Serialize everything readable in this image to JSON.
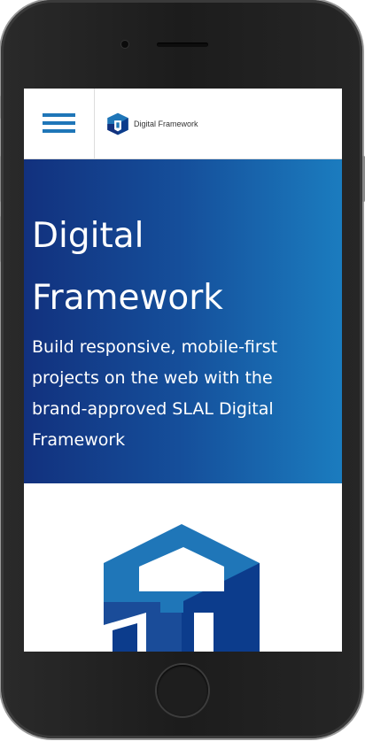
{
  "header": {
    "menu_icon": "hamburger-menu-icon",
    "logo_icon": "digital-framework-logo-icon",
    "brand_name": "Digital Framework"
  },
  "hero": {
    "title": "Digital Framework",
    "subtitle": "Build responsive, mobile-first projects on the web with the brand-approved SLAL Digital Framework"
  },
  "colors": {
    "brand_blue": "#1f76b8",
    "logo_navy": "#0c3c8c",
    "hero_gradient_start": "#12317e",
    "hero_gradient_end": "#1b7cbf"
  }
}
